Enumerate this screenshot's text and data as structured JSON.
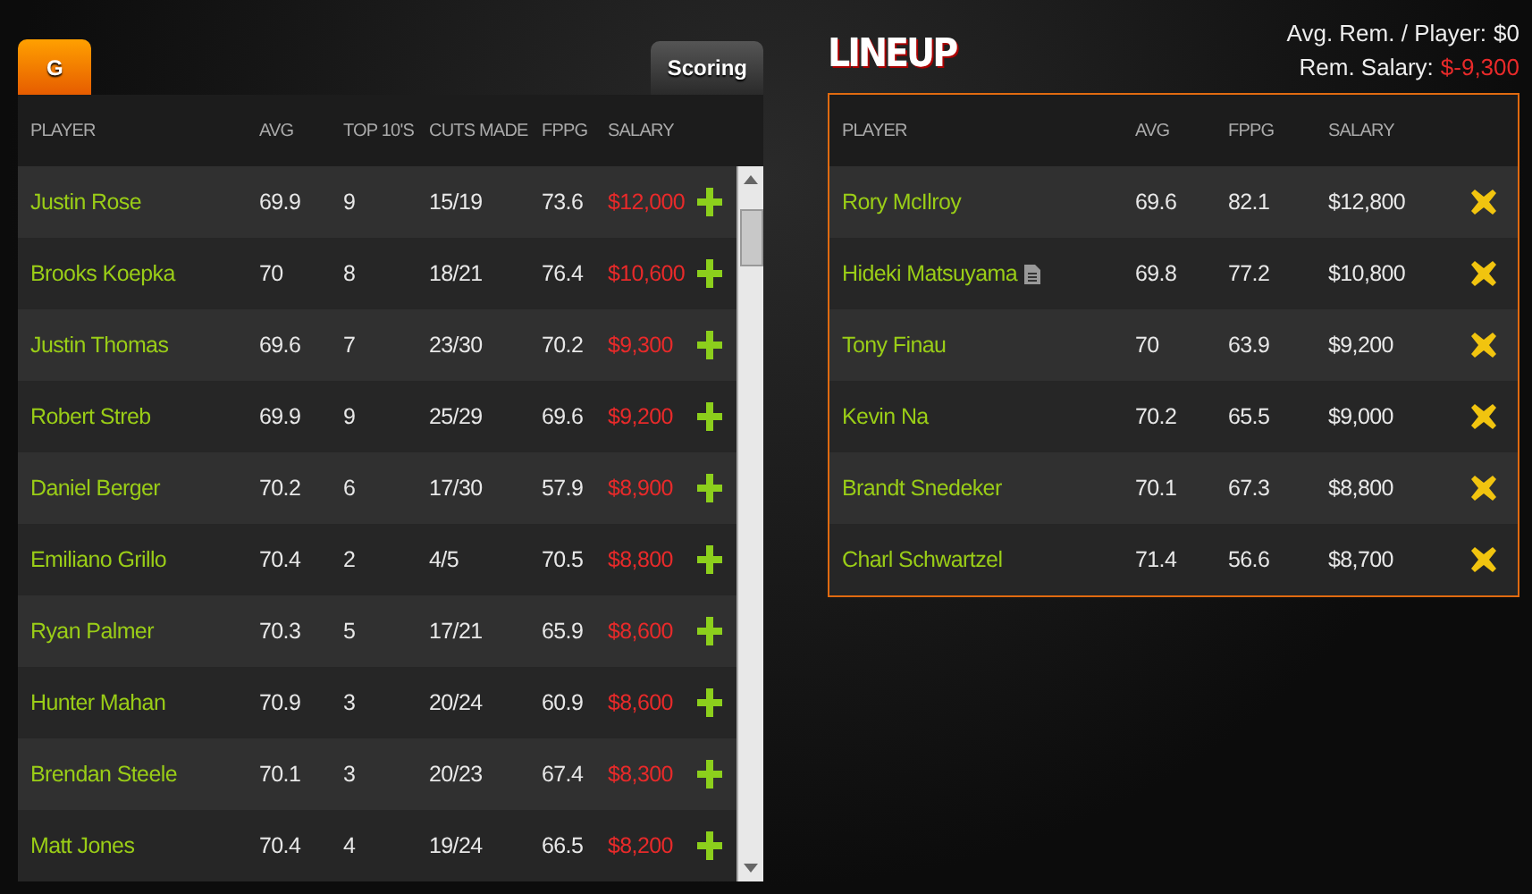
{
  "tabs": [
    {
      "label": "G",
      "selected": true
    },
    {
      "label": "Scoring",
      "selected": false
    }
  ],
  "players": {
    "columns": [
      "PLAYER",
      "AVG",
      "TOP 10'S",
      "CUTS MADE",
      "FPPG",
      "SALARY"
    ],
    "rows": [
      {
        "player": "Justin Rose",
        "avg": "69.9",
        "top10": "9",
        "cuts": "15/19",
        "fppg": "73.6",
        "salary": "$12,000"
      },
      {
        "player": "Brooks Koepka",
        "avg": "70",
        "top10": "8",
        "cuts": "18/21",
        "fppg": "76.4",
        "salary": "$10,600"
      },
      {
        "player": "Justin Thomas",
        "avg": "69.6",
        "top10": "7",
        "cuts": "23/30",
        "fppg": "70.2",
        "salary": "$9,300"
      },
      {
        "player": "Robert Streb",
        "avg": "69.9",
        "top10": "9",
        "cuts": "25/29",
        "fppg": "69.6",
        "salary": "$9,200"
      },
      {
        "player": "Daniel Berger",
        "avg": "70.2",
        "top10": "6",
        "cuts": "17/30",
        "fppg": "57.9",
        "salary": "$8,900"
      },
      {
        "player": "Emiliano Grillo",
        "avg": "70.4",
        "top10": "2",
        "cuts": "4/5",
        "fppg": "70.5",
        "salary": "$8,800"
      },
      {
        "player": "Ryan Palmer",
        "avg": "70.3",
        "top10": "5",
        "cuts": "17/21",
        "fppg": "65.9",
        "salary": "$8,600"
      },
      {
        "player": "Hunter Mahan",
        "avg": "70.9",
        "top10": "3",
        "cuts": "20/24",
        "fppg": "60.9",
        "salary": "$8,600"
      },
      {
        "player": "Brendan Steele",
        "avg": "70.1",
        "top10": "3",
        "cuts": "20/23",
        "fppg": "67.4",
        "salary": "$8,300"
      },
      {
        "player": "Matt Jones",
        "avg": "70.4",
        "top10": "4",
        "cuts": "19/24",
        "fppg": "66.5",
        "salary": "$8,200"
      }
    ]
  },
  "lineup": {
    "title": "LINEUP",
    "avg_remaining_label": "Avg. Rem. / Player:",
    "avg_remaining": "$0",
    "remaining_salary_label": "Rem. Salary:",
    "remaining_salary": "$-9,300",
    "columns": [
      "PLAYER",
      "AVG",
      "FPPG",
      "SALARY"
    ],
    "rows": [
      {
        "player": "Rory McIlroy",
        "has_note": false,
        "avg": "69.6",
        "fppg": "82.1",
        "salary": "$12,800"
      },
      {
        "player": "Hideki Matsuyama",
        "has_note": true,
        "avg": "69.8",
        "fppg": "77.2",
        "salary": "$10,800"
      },
      {
        "player": "Tony Finau",
        "has_note": false,
        "avg": "70",
        "fppg": "63.9",
        "salary": "$9,200"
      },
      {
        "player": "Kevin Na",
        "has_note": false,
        "avg": "70.2",
        "fppg": "65.5",
        "salary": "$9,000"
      },
      {
        "player": "Brandt Snedeker",
        "has_note": false,
        "avg": "70.1",
        "fppg": "67.3",
        "salary": "$8,800"
      },
      {
        "player": "Charl Schwartzel",
        "has_note": false,
        "avg": "71.4",
        "fppg": "56.6",
        "salary": "$8,700"
      }
    ]
  }
}
